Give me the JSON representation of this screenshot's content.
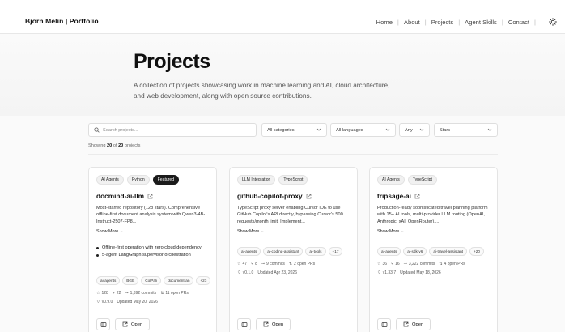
{
  "nav": {
    "brand": "Bjorn Melin | Portfolio",
    "links": [
      "Home",
      "About",
      "Projects",
      "Agent Skills",
      "Contact"
    ],
    "theme_icon": "sun-icon"
  },
  "hero": {
    "title": "Projects",
    "description": "A collection of projects showcasing work in machine learning and AI, cloud architecture, and web development, along with open source contributions."
  },
  "filters": {
    "search_placeholder": "Search projects...",
    "category": "All categories",
    "language": "All languages",
    "range": "Any",
    "sort": "Stars"
  },
  "results": {
    "prefix": "Showing",
    "shown": "20",
    "of": "of",
    "total": "20",
    "suffix": "projects"
  },
  "show_more_label": "Show More",
  "open_label": "Open",
  "cards": [
    {
      "tags": [
        "AI Agents",
        "Python",
        "Featured"
      ],
      "title": "docmind-ai-llm",
      "description": "Most-starred repository (128 stars). Comprehensive offline-first document analysis system with Qwen3-4B-Instruct-2507-FP8...",
      "bullets": [
        "Offline-first operation with zero cloud dependency",
        "5-agent LangGraph supervisor orchestration"
      ],
      "topics": [
        "ai-agents",
        "BGE",
        "ColPali",
        "document-an",
        "+23"
      ],
      "stars": "128",
      "forks": "22",
      "commits": "1,392 commits",
      "prs": "11 open PRs",
      "version": "v0.9.0",
      "updated": "Updated May 20, 2026"
    },
    {
      "tags": [
        "LLM Integration",
        "TypeScript"
      ],
      "title": "github-copilot-proxy",
      "description": "TypeScript proxy server enabling Cursor IDE to use GitHub Copilot's API directly, bypassing Cursor's 500 requests/month limit. Implement...",
      "topics": [
        "ai-agents",
        "ai-coding-assistant",
        "ai-tools",
        "+17"
      ],
      "stars": "47",
      "forks": "8",
      "commits": "9 commits",
      "prs": "2 open PRs",
      "version": "v0.1.0",
      "updated": "Updated Apr 23, 2026"
    },
    {
      "tags": [
        "AI Agents",
        "TypeScript"
      ],
      "title": "tripsage-ai",
      "description": "Production-ready sophisticated travel planning platform with 15+ AI tools, multi-provider LLM routing (OpenAI, Anthropic, xAI, OpenRouter),...",
      "topics": [
        "ai-agents",
        "ai-sdk-v6",
        "ai-travel-assistant",
        "+20"
      ],
      "stars": "36",
      "forks": "16",
      "commits": "3,222 commits",
      "prs": "4 open PRs",
      "version": "v1.33.7",
      "updated": "Updated May 18, 2026"
    }
  ]
}
